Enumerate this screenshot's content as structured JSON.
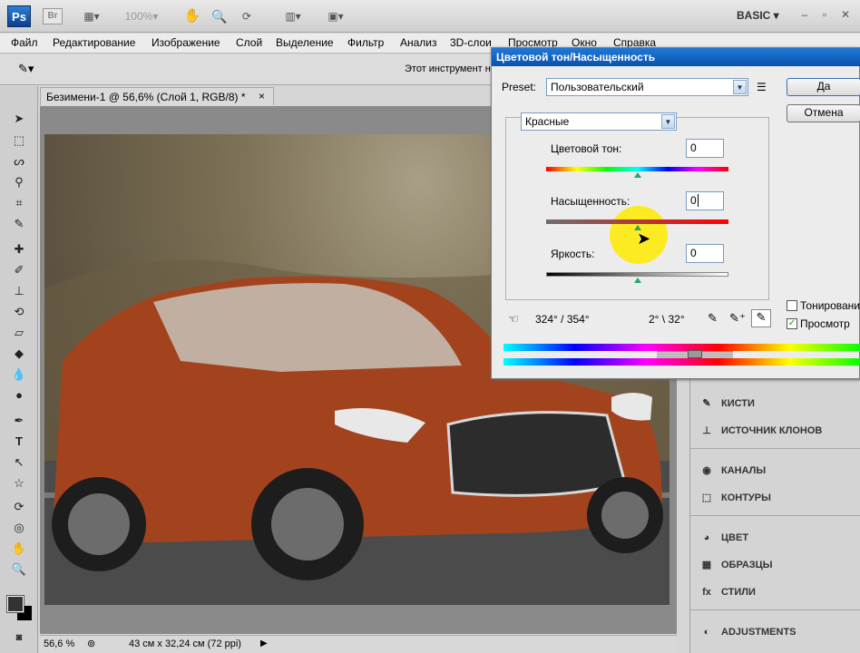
{
  "app": {
    "logo": "Ps",
    "bridge": "Br",
    "zoom_combo": "100%",
    "workspace": "BASIC"
  },
  "menu": [
    "Файл",
    "Редактирование",
    "Изображение",
    "Слой",
    "Выделение",
    "Фильтр",
    "Анализ",
    "3D-слои",
    "Просмотр",
    "Окно",
    "Справка"
  ],
  "options_bar": {
    "hint": "Этот инструмент н"
  },
  "document": {
    "title": "Безимени-1 @ 56,6% (Слой 1, RGB/8) *",
    "close": "×",
    "zoom_status": "56,6 %",
    "size_status": "43 см x 32,24 см (72 ppi)"
  },
  "panels": [
    {
      "icon": "brush-icon",
      "label": "КИСТИ"
    },
    {
      "icon": "clone-source-icon",
      "label": "ИСТОЧНИК КЛОНОВ"
    },
    {
      "icon": "channels-icon",
      "label": "КАНАЛЫ"
    },
    {
      "icon": "paths-icon",
      "label": "КОНТУРЫ"
    },
    {
      "icon": "color-icon",
      "label": "ЦВЕТ"
    },
    {
      "icon": "swatches-icon",
      "label": "ОБРАЗЦЫ"
    },
    {
      "icon": "styles-icon",
      "label": "СТИЛИ"
    },
    {
      "icon": "adjustments-icon",
      "label": "ADJUSTMENTS"
    }
  ],
  "dialog": {
    "title": "Цветовой тон/Насыщенность",
    "preset_label": "Preset:",
    "preset_value": "Пользовательский",
    "ok": "Да",
    "cancel": "Отмена",
    "channel": "Красные",
    "hue_label": "Цветовой тон:",
    "hue_value": "0",
    "saturation_label": "Насыщенность:",
    "saturation_value": "0",
    "lightness_label": "Яркость:",
    "lightness_value": "0",
    "range_left": "324° / 354°",
    "range_right": "2° \\ 32°",
    "colorize_label": "Тонировани",
    "colorize_checked": false,
    "preview_label": "Просмотр",
    "preview_checked": true
  }
}
